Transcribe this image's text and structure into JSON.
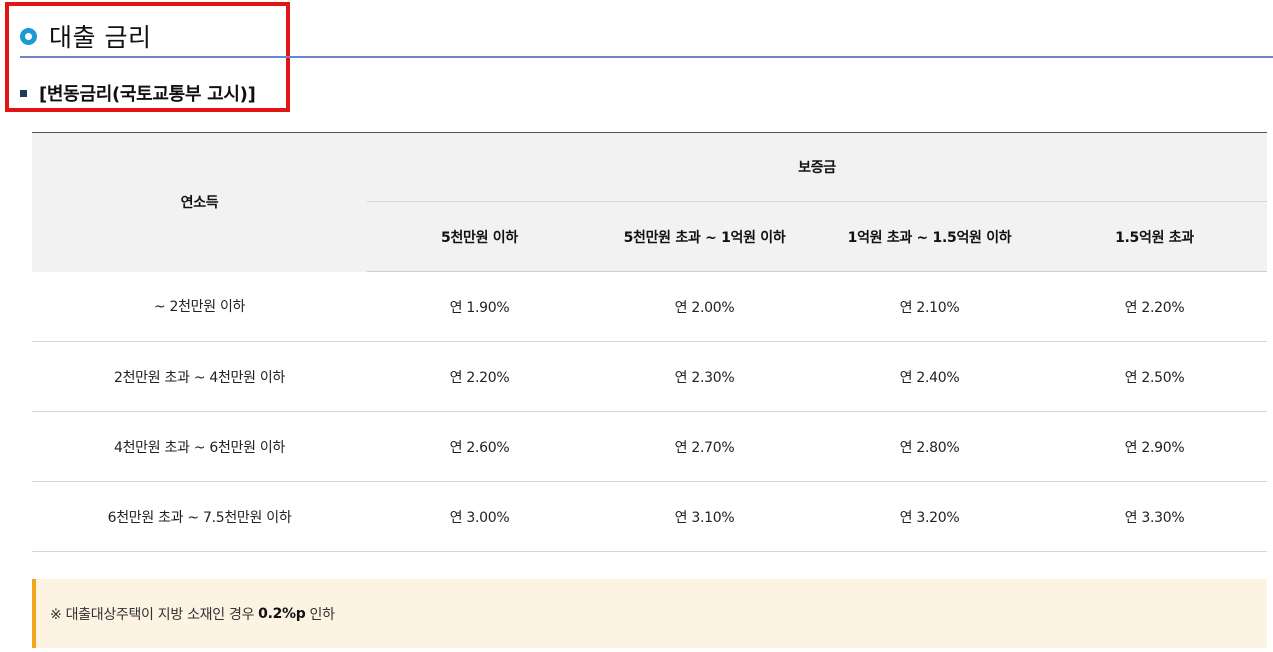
{
  "section": {
    "title": "대출 금리",
    "subtitle": "[변동금리(국토교통부 고시)]"
  },
  "table": {
    "row_header": "연소득",
    "group_header": "보증금",
    "columns": [
      "5천만원 이하",
      "5천만원 초과 ~ 1억원 이하",
      "1억원 초과 ~ 1.5억원 이하",
      "1.5억원 초과"
    ],
    "rows": [
      {
        "income": "~ 2천만원 이하",
        "rates": [
          "연 1.90%",
          "연 2.00%",
          "연 2.10%",
          "연 2.20%"
        ]
      },
      {
        "income": "2천만원 초과 ~ 4천만원 이하",
        "rates": [
          "연 2.20%",
          "연 2.30%",
          "연 2.40%",
          "연 2.50%"
        ]
      },
      {
        "income": "4천만원 초과 ~ 6천만원 이하",
        "rates": [
          "연 2.60%",
          "연 2.70%",
          "연 2.80%",
          "연 2.90%"
        ]
      },
      {
        "income": "6천만원 초과 ~ 7.5천만원 이하",
        "rates": [
          "연 3.00%",
          "연 3.10%",
          "연 3.20%",
          "연 3.30%"
        ]
      }
    ]
  },
  "note": {
    "prefix": "※ 대출대상주택이 지방 소재인 경우",
    "emphasis": "0.2%p",
    "suffix": "인하"
  },
  "colors": {
    "highlight_border": "#e31414",
    "title_icon": "#1b9ad6",
    "title_rule": "#6e84c8",
    "note_accent": "#f2a51e",
    "note_background": "#fdf3e3"
  }
}
